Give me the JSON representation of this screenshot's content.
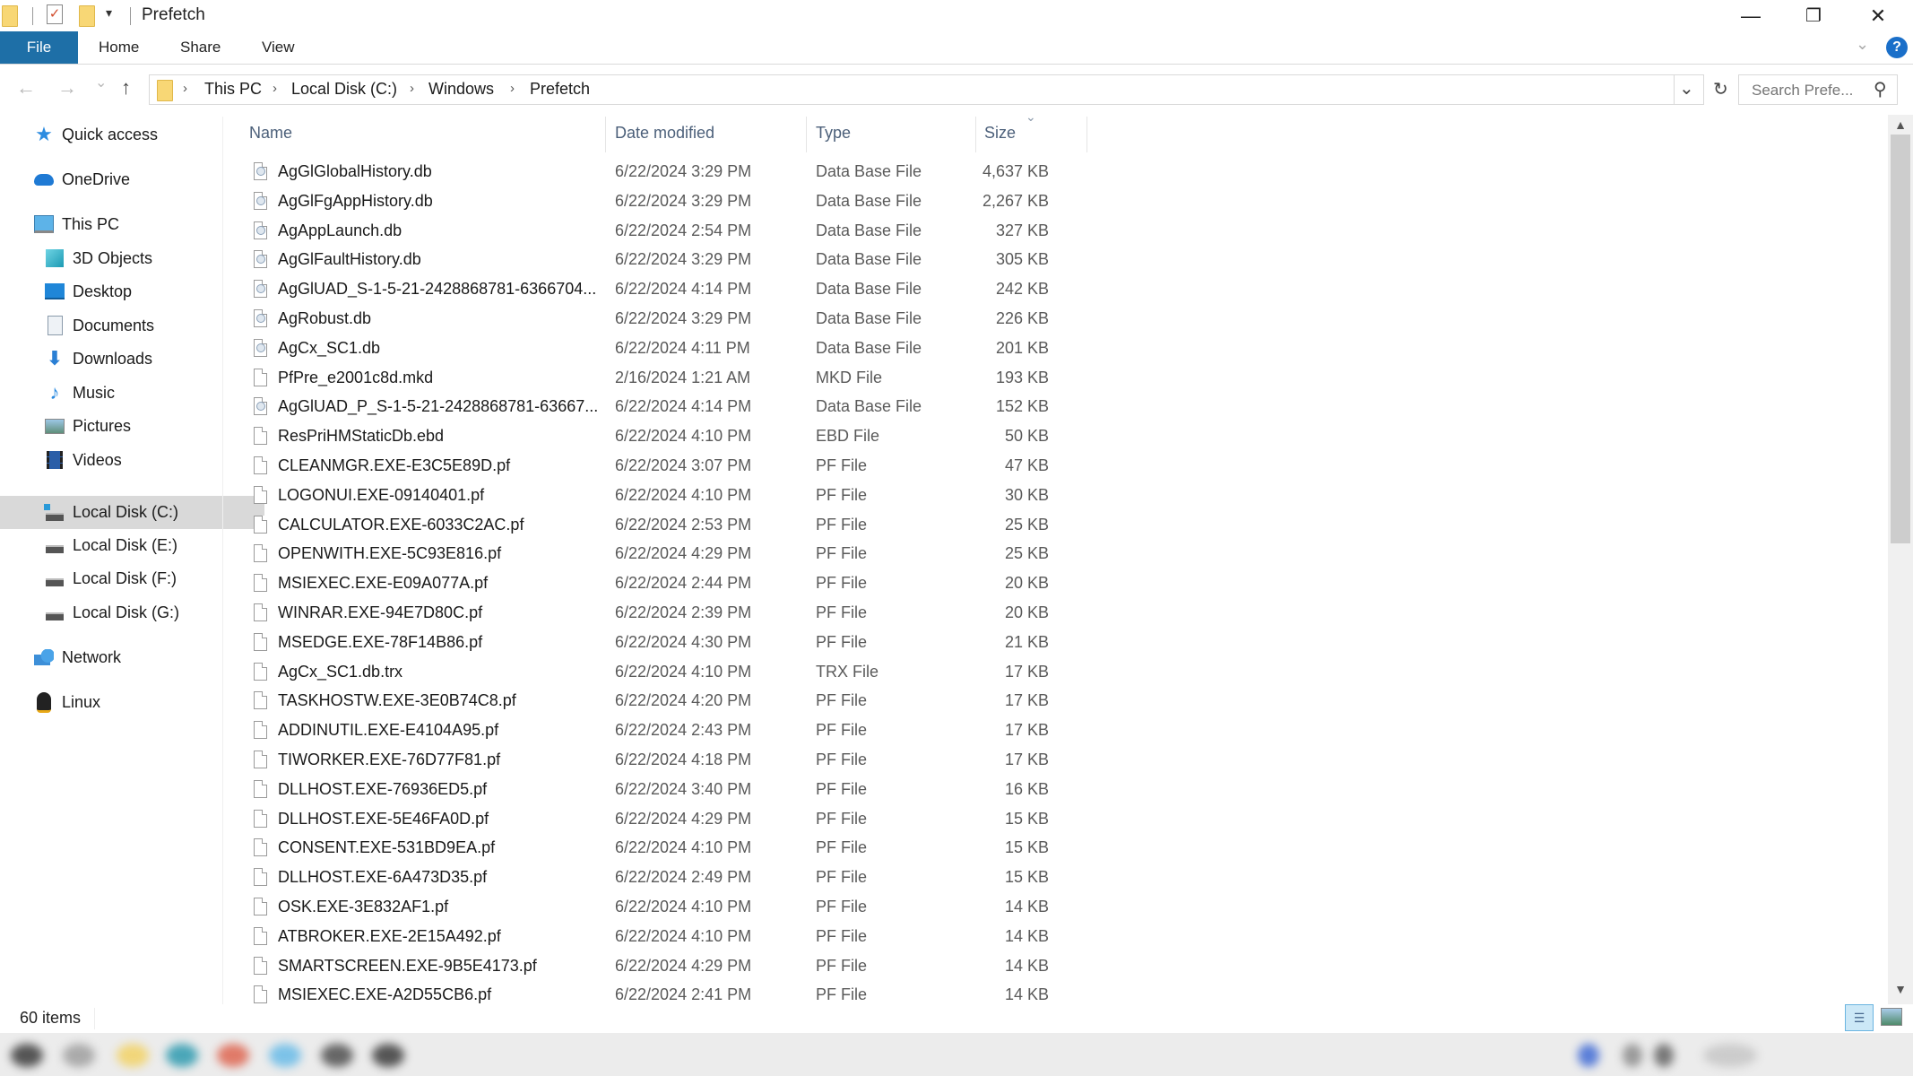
{
  "window": {
    "title": "Prefetch",
    "controls": {
      "minimize": "—",
      "restore": "❐",
      "close": "✕"
    }
  },
  "ribbon": {
    "tabs": [
      {
        "label": "File",
        "active": true
      },
      {
        "label": "Home"
      },
      {
        "label": "Share"
      },
      {
        "label": "View"
      }
    ],
    "expand_icon": "chevron-down-icon",
    "help_label": "?"
  },
  "navigation": {
    "back": "←",
    "forward": "→",
    "recent": "⌄",
    "up": "↑",
    "breadcrumb": [
      "This PC",
      "Local Disk (C:)",
      "Windows",
      "Prefetch"
    ],
    "refresh": "↻",
    "dropdown": "⌄"
  },
  "search": {
    "placeholder": "Search Prefe...",
    "icon": "⚲"
  },
  "sidebar": {
    "items": [
      {
        "label": "Quick access",
        "icon": "star-icon",
        "level": 0
      },
      {
        "label": "OneDrive",
        "icon": "cloud-icon",
        "level": 0
      },
      {
        "label": "This PC",
        "icon": "monitor-icon",
        "level": 0
      },
      {
        "label": "3D Objects",
        "icon": "cube-icon",
        "level": 1
      },
      {
        "label": "Desktop",
        "icon": "desktop-icon",
        "level": 1
      },
      {
        "label": "Documents",
        "icon": "document-icon",
        "level": 1
      },
      {
        "label": "Downloads",
        "icon": "download-arrow-icon",
        "level": 1
      },
      {
        "label": "Music",
        "icon": "music-note-icon",
        "level": 1
      },
      {
        "label": "Pictures",
        "icon": "picture-icon",
        "level": 1
      },
      {
        "label": "Videos",
        "icon": "film-icon",
        "level": 1
      },
      {
        "label": "Local Disk (C:)",
        "icon": "system-drive-icon",
        "level": 1,
        "selected": true
      },
      {
        "label": "Local Disk (E:)",
        "icon": "drive-icon",
        "level": 1
      },
      {
        "label": "Local Disk (F:)",
        "icon": "drive-icon",
        "level": 1
      },
      {
        "label": "Local Disk (G:)",
        "icon": "drive-icon",
        "level": 1
      },
      {
        "label": "Network",
        "icon": "network-icon",
        "level": 0
      },
      {
        "label": "Linux",
        "icon": "penguin-icon",
        "level": 0
      }
    ]
  },
  "columns": {
    "name": "Name",
    "date": "Date modified",
    "type": "Type",
    "size": "Size",
    "sorted_by": "Size",
    "sort_direction": "descending"
  },
  "files": [
    {
      "name": "AgGlGlobalHistory.db",
      "date": "6/22/2024 3:29 PM",
      "type": "Data Base File",
      "size": "4,637 KB",
      "icon": "db"
    },
    {
      "name": "AgGlFgAppHistory.db",
      "date": "6/22/2024 3:29 PM",
      "type": "Data Base File",
      "size": "2,267 KB",
      "icon": "db"
    },
    {
      "name": "AgAppLaunch.db",
      "date": "6/22/2024 2:54 PM",
      "type": "Data Base File",
      "size": "327 KB",
      "icon": "db"
    },
    {
      "name": "AgGlFaultHistory.db",
      "date": "6/22/2024 3:29 PM",
      "type": "Data Base File",
      "size": "305 KB",
      "icon": "db"
    },
    {
      "name": "AgGlUAD_S-1-5-21-2428868781-6366704...",
      "date": "6/22/2024 4:14 PM",
      "type": "Data Base File",
      "size": "242 KB",
      "icon": "db"
    },
    {
      "name": "AgRobust.db",
      "date": "6/22/2024 3:29 PM",
      "type": "Data Base File",
      "size": "226 KB",
      "icon": "db"
    },
    {
      "name": "AgCx_SC1.db",
      "date": "6/22/2024 4:11 PM",
      "type": "Data Base File",
      "size": "201 KB",
      "icon": "db"
    },
    {
      "name": "PfPre_e2001c8d.mkd",
      "date": "2/16/2024 1:21 AM",
      "type": "MKD File",
      "size": "193 KB",
      "icon": "blank"
    },
    {
      "name": "AgGlUAD_P_S-1-5-21-2428868781-63667...",
      "date": "6/22/2024 4:14 PM",
      "type": "Data Base File",
      "size": "152 KB",
      "icon": "db"
    },
    {
      "name": "ResPriHMStaticDb.ebd",
      "date": "6/22/2024 4:10 PM",
      "type": "EBD File",
      "size": "50 KB",
      "icon": "blank"
    },
    {
      "name": "CLEANMGR.EXE-E3C5E89D.pf",
      "date": "6/22/2024 3:07 PM",
      "type": "PF File",
      "size": "47 KB",
      "icon": "blank"
    },
    {
      "name": "LOGONUI.EXE-09140401.pf",
      "date": "6/22/2024 4:10 PM",
      "type": "PF File",
      "size": "30 KB",
      "icon": "blank"
    },
    {
      "name": "CALCULATOR.EXE-6033C2AC.pf",
      "date": "6/22/2024 2:53 PM",
      "type": "PF File",
      "size": "25 KB",
      "icon": "blank"
    },
    {
      "name": "OPENWITH.EXE-5C93E816.pf",
      "date": "6/22/2024 4:29 PM",
      "type": "PF File",
      "size": "25 KB",
      "icon": "blank"
    },
    {
      "name": "MSIEXEC.EXE-E09A077A.pf",
      "date": "6/22/2024 2:44 PM",
      "type": "PF File",
      "size": "20 KB",
      "icon": "blank"
    },
    {
      "name": "WINRAR.EXE-94E7D80C.pf",
      "date": "6/22/2024 2:39 PM",
      "type": "PF File",
      "size": "20 KB",
      "icon": "blank"
    },
    {
      "name": "MSEDGE.EXE-78F14B86.pf",
      "date": "6/22/2024 4:30 PM",
      "type": "PF File",
      "size": "21 KB",
      "icon": "blank"
    },
    {
      "name": "AgCx_SC1.db.trx",
      "date": "6/22/2024 4:10 PM",
      "type": "TRX File",
      "size": "17 KB",
      "icon": "blank"
    },
    {
      "name": "TASKHOSTW.EXE-3E0B74C8.pf",
      "date": "6/22/2024 4:20 PM",
      "type": "PF File",
      "size": "17 KB",
      "icon": "blank"
    },
    {
      "name": "ADDINUTIL.EXE-E4104A95.pf",
      "date": "6/22/2024 2:43 PM",
      "type": "PF File",
      "size": "17 KB",
      "icon": "blank"
    },
    {
      "name": "TIWORKER.EXE-76D77F81.pf",
      "date": "6/22/2024 4:18 PM",
      "type": "PF File",
      "size": "17 KB",
      "icon": "blank"
    },
    {
      "name": "DLLHOST.EXE-76936ED5.pf",
      "date": "6/22/2024 3:40 PM",
      "type": "PF File",
      "size": "16 KB",
      "icon": "blank"
    },
    {
      "name": "DLLHOST.EXE-5E46FA0D.pf",
      "date": "6/22/2024 4:29 PM",
      "type": "PF File",
      "size": "15 KB",
      "icon": "blank"
    },
    {
      "name": "CONSENT.EXE-531BD9EA.pf",
      "date": "6/22/2024 4:10 PM",
      "type": "PF File",
      "size": "15 KB",
      "icon": "blank"
    },
    {
      "name": "DLLHOST.EXE-6A473D35.pf",
      "date": "6/22/2024 2:49 PM",
      "type": "PF File",
      "size": "15 KB",
      "icon": "blank"
    },
    {
      "name": "OSK.EXE-3E832AF1.pf",
      "date": "6/22/2024 4:10 PM",
      "type": "PF File",
      "size": "14 KB",
      "icon": "blank"
    },
    {
      "name": "ATBROKER.EXE-2E15A492.pf",
      "date": "6/22/2024 4:10 PM",
      "type": "PF File",
      "size": "14 KB",
      "icon": "blank"
    },
    {
      "name": "SMARTSCREEN.EXE-9B5E4173.pf",
      "date": "6/22/2024 4:29 PM",
      "type": "PF File",
      "size": "14 KB",
      "icon": "blank"
    },
    {
      "name": "MSIEXEC.EXE-A2D55CB6.pf",
      "date": "6/22/2024 2:41 PM",
      "type": "PF File",
      "size": "14 KB",
      "icon": "blank"
    }
  ],
  "status": {
    "item_count": "60 items"
  },
  "scrollbar": {
    "position_fraction": 0.0,
    "visible_fraction": 0.48
  },
  "colors": {
    "accent": "#1e6fa7",
    "selection": "#d9d9d9",
    "header_text": "#4c607a",
    "help": "#1a6fc9"
  }
}
